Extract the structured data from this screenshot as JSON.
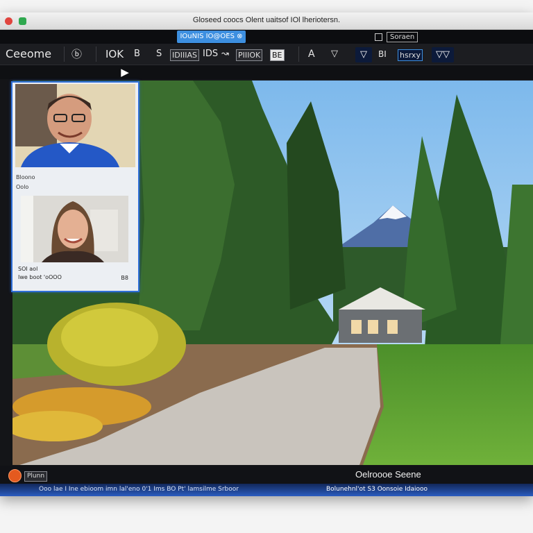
{
  "window": {
    "title": "Gloseed coocs Olent uaitsof IOl lheriotersn."
  },
  "tabs": {
    "active_label": "IOuNIS IO@OES ⊗",
    "right_label": "Soraen"
  },
  "toolbar": {
    "app_name": "Ceeome",
    "icon_glyph": "ⓑ",
    "item_1": "IOK",
    "item_2": "B",
    "item_3": "S",
    "item_4": "IDIIIAS",
    "item_5": "IDS",
    "item_6": "↝",
    "item_7": "PIIIOK",
    "item_8": "BE",
    "item_9": "A",
    "item_10": "▽",
    "item_11": "▽",
    "item_12": "BI",
    "item_13": "hsrxy",
    "item_14": "▽▽"
  },
  "participants": {
    "name_1": "Bloono",
    "sub_1": "Oolo",
    "caption_2a": "SOI aol",
    "caption_2b": "Iwe boot 'oOOO",
    "value_2": "B8"
  },
  "bottom": {
    "rec_label": "Plunn",
    "scene_title": "Oelroooe Seene",
    "status_left": "Ooo lae I Ine ebioom imn lal'eno 0'1 Ims BO Pt' lamsilme Srboor",
    "status_right": "Bolunehnl'ot  S3 Oonsoie Idaiooo"
  },
  "colors": {
    "accent": "#3d8fe0",
    "panel_border": "#2f6fd8",
    "record": "#e45a1f"
  }
}
